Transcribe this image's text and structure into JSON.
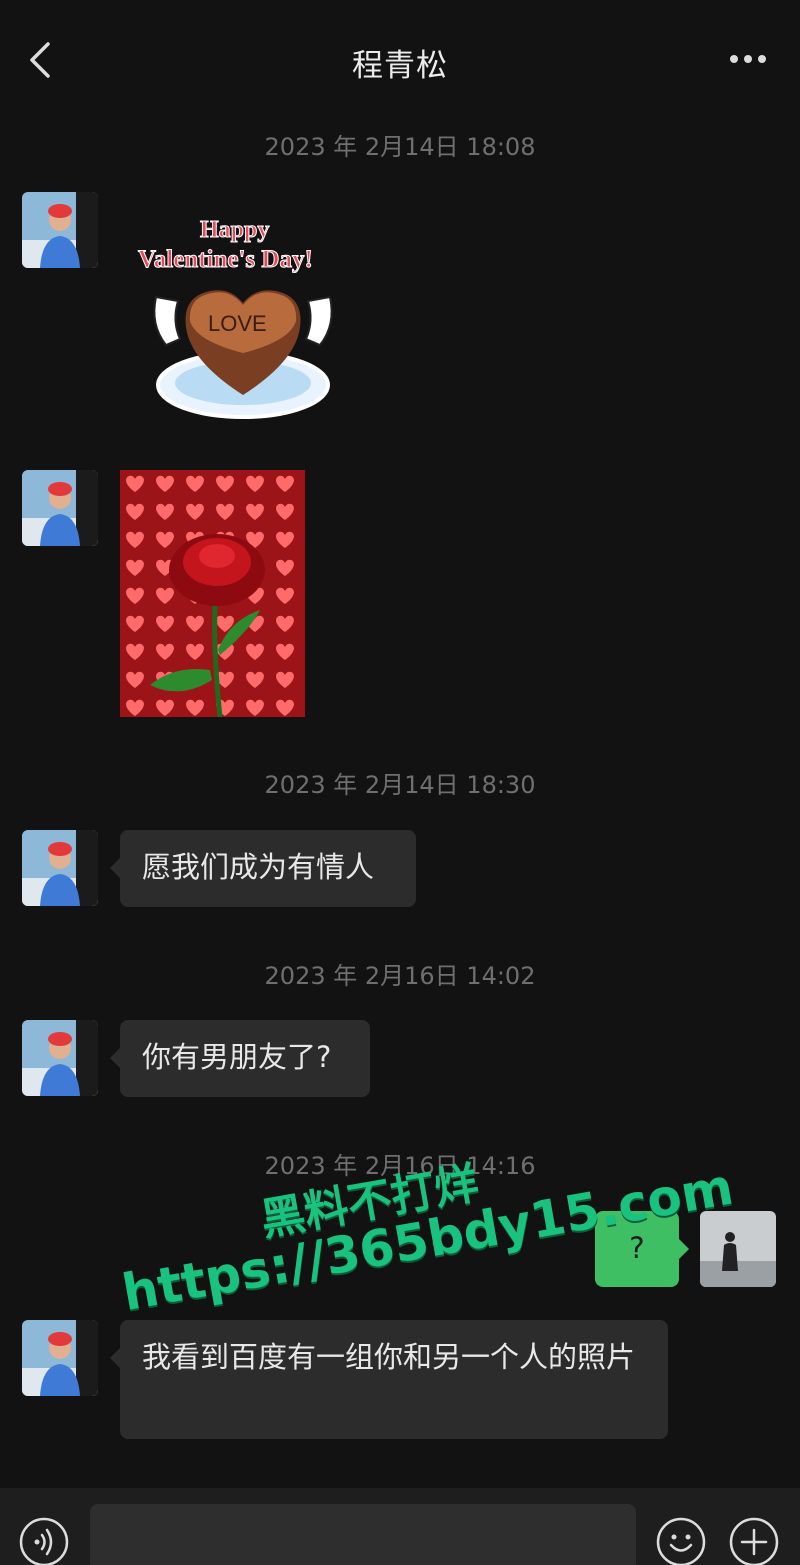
{
  "header": {
    "title": "程青松"
  },
  "messages": {
    "ts1": "2023 年 2月14日 18:08",
    "ts2": "2023 年 2月14日 18:30",
    "ts3": "2023 年 2月16日 14:02",
    "ts4": "2023 年 2月16日 14:16",
    "sticker": {
      "line1": "Happy",
      "line2": "Valentine's Day!",
      "cake": "LOVE"
    },
    "text1": "愿我们成为有情人",
    "text2": "你有男朋友了?",
    "self_text": "?",
    "text3": "我看到百度有一组你和另一个人的照片"
  },
  "watermark": {
    "line1": "黑料不打烊",
    "line2": "https://365bdy15.com"
  },
  "input": {
    "placeholder": ""
  },
  "colors": {
    "background": "#121212",
    "bubble_other": "#2c2c2c",
    "bubble_self": "#3fbf64",
    "watermark": "#19c27e"
  },
  "icons": [
    "back-arrow-icon",
    "more-dots-icon",
    "voice-icon",
    "emoji-icon",
    "plus-icon"
  ]
}
